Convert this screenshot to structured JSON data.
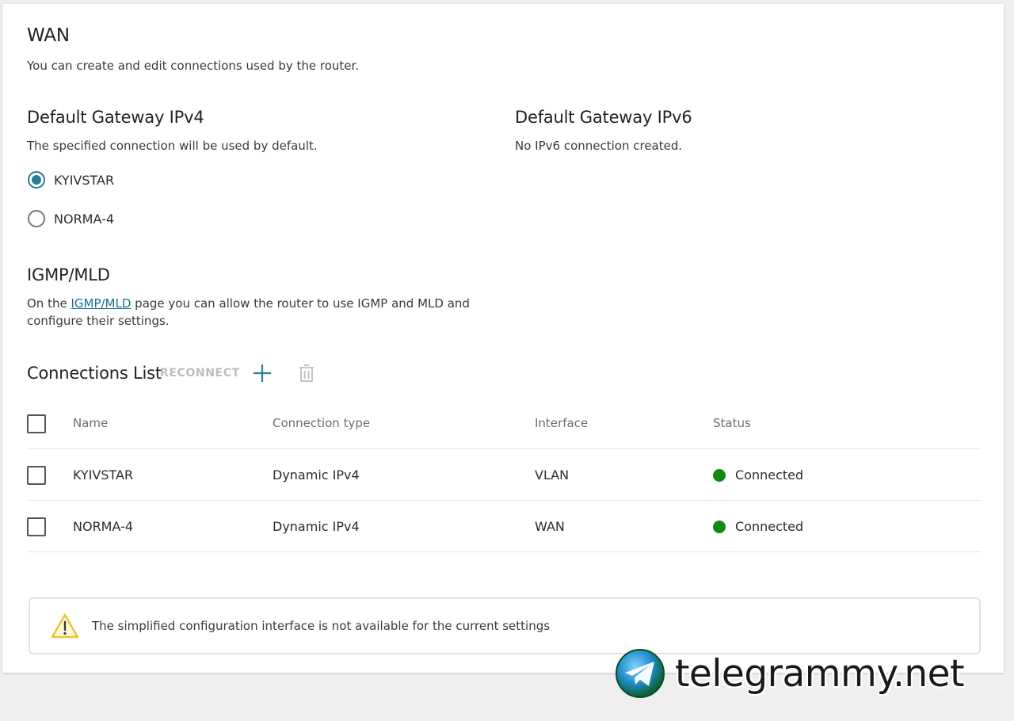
{
  "wan": {
    "title": "WAN",
    "description": "You can create and edit connections used by the router."
  },
  "gateway_ipv4": {
    "title": "Default Gateway IPv4",
    "description": "The specified connection will be used by default.",
    "options": [
      {
        "label": "KYIVSTAR",
        "selected": true
      },
      {
        "label": "NORMA-4",
        "selected": false
      }
    ]
  },
  "gateway_ipv6": {
    "title": "Default Gateway IPv6",
    "description": "No IPv6 connection created."
  },
  "igmp": {
    "title": "IGMP/MLD",
    "text_before": "On the ",
    "link": "IGMP/MLD",
    "text_after": " page you can allow the router to use IGMP and MLD and",
    "text_line2": "configure their settings."
  },
  "connections": {
    "title": "Connections List",
    "reconnect_label": "RECONNECT",
    "add_icon": "plus-icon",
    "delete_icon": "trash-icon",
    "columns": {
      "name": "Name",
      "type": "Connection type",
      "interface": "Interface",
      "status": "Status"
    },
    "rows": [
      {
        "name": "KYIVSTAR",
        "type": "Dynamic IPv4",
        "interface": "VLAN",
        "status": "Connected"
      },
      {
        "name": "NORMA-4",
        "type": "Dynamic IPv4",
        "interface": "WAN",
        "status": "Connected"
      }
    ],
    "status_color": "#108a10"
  },
  "notice": {
    "icon": "warning-icon",
    "text": "The simplified configuration interface is not available for the current settings"
  },
  "watermark": {
    "text": "telegrammy.net",
    "icon": "telegram-logo"
  },
  "colors": {
    "accent": "#2a7b95",
    "link": "#1a6f8a",
    "connected": "#108a10",
    "warning": "#e8c33a"
  }
}
